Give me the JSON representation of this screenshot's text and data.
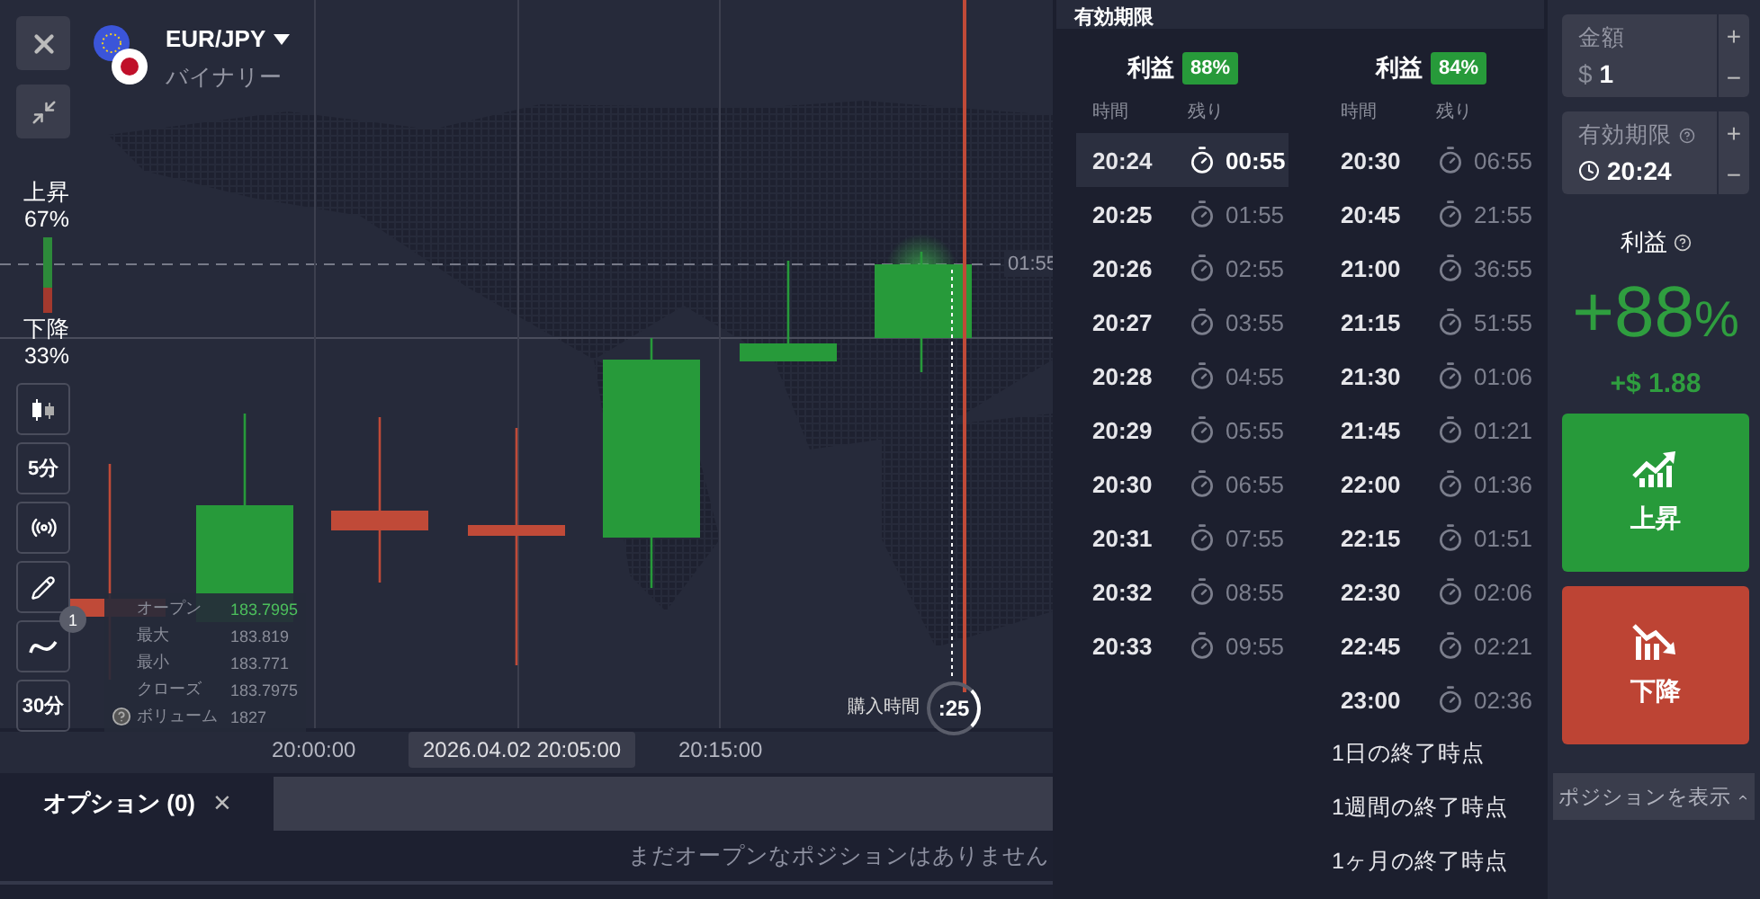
{
  "instrument": {
    "symbol": "EUR/JPY",
    "type": "バイナリー"
  },
  "toolbar": [
    {
      "kind": "candles"
    },
    {
      "kind": "text",
      "label": "5分"
    },
    {
      "kind": "signal"
    },
    {
      "kind": "pencil"
    },
    {
      "kind": "indicator",
      "badge": "1"
    },
    {
      "kind": "text",
      "label": "30分"
    }
  ],
  "sentiment": {
    "up_label": "上昇",
    "up_value": "67%",
    "down_label": "下降",
    "down_value": "33%",
    "level": 0.67
  },
  "ohlc": [
    {
      "label": "オープン",
      "value": "183.7995"
    },
    {
      "label": "最大",
      "value": "183.819"
    },
    {
      "label": "最小",
      "value": "183.771"
    },
    {
      "label": "クローズ",
      "value": "183.7975"
    },
    {
      "label": "ボリューム",
      "value": "1827"
    }
  ],
  "x_axis": [
    "20:00:00",
    "20:15:00"
  ],
  "crosshair_time": "2026.04.02 20:05:00",
  "price_label": "01:55",
  "purchase": {
    "label": "購入時間",
    "countdown": ":25"
  },
  "bottom_tabs": [
    {
      "label": "オプション (0)",
      "close": "×",
      "selected": true
    }
  ],
  "empty_message": "まだオープンなポジションはありません",
  "expiry_menu": {
    "title": "有効期限",
    "columns": [
      {
        "profit_label": "利益",
        "profit": "88%",
        "time_header": "時間",
        "remaining_header": "残り",
        "rows": [
          {
            "time": "20:24",
            "remaining": "00:55",
            "selected": true
          },
          {
            "time": "20:25",
            "remaining": "01:55",
            "selected": false
          },
          {
            "time": "20:26",
            "remaining": "02:55",
            "selected": false
          },
          {
            "time": "20:27",
            "remaining": "03:55",
            "selected": false
          },
          {
            "time": "20:28",
            "remaining": "04:55",
            "selected": false
          },
          {
            "time": "20:29",
            "remaining": "05:55",
            "selected": false
          },
          {
            "time": "20:30",
            "remaining": "06:55",
            "selected": false
          },
          {
            "time": "20:31",
            "remaining": "07:55",
            "selected": false
          },
          {
            "time": "20:32",
            "remaining": "08:55",
            "selected": false
          },
          {
            "time": "20:33",
            "remaining": "09:55",
            "selected": false
          }
        ]
      },
      {
        "profit_label": "利益",
        "profit": "84%",
        "time_header": "時間",
        "remaining_header": "残り",
        "rows": [
          {
            "time": "20:30",
            "remaining": "06:55",
            "selected": false
          },
          {
            "time": "20:45",
            "remaining": "21:55",
            "selected": false
          },
          {
            "time": "21:00",
            "remaining": "36:55",
            "selected": false
          },
          {
            "time": "21:15",
            "remaining": "51:55",
            "selected": false
          },
          {
            "time": "21:30",
            "remaining": "01:06",
            "selected": false
          },
          {
            "time": "21:45",
            "remaining": "01:21",
            "selected": false
          },
          {
            "time": "22:00",
            "remaining": "01:36",
            "selected": false
          },
          {
            "time": "22:15",
            "remaining": "01:51",
            "selected": false
          },
          {
            "time": "22:30",
            "remaining": "02:06",
            "selected": false
          },
          {
            "time": "22:45",
            "remaining": "02:21",
            "selected": false
          },
          {
            "time": "23:00",
            "remaining": "02:36",
            "selected": false
          }
        ],
        "extras": [
          "1日の終了時点",
          "1週間の終了時点",
          "1ヶ月の終了時点"
        ]
      }
    ]
  },
  "trade_panel": {
    "amount_label": "金額",
    "currency": "$",
    "amount": "1",
    "increment": "+",
    "decrement": "−",
    "expiry_label": "有効期限",
    "expiry": "20:24",
    "profit_label": "利益",
    "profit_percent": "+88",
    "percent_sign": "%",
    "profit_amount": "+$ 1.88",
    "buttons": [
      {
        "kind": "up",
        "label": "上昇"
      },
      {
        "kind": "down",
        "label": "下降"
      }
    ],
    "show_positions": "ポジションを表示"
  }
}
